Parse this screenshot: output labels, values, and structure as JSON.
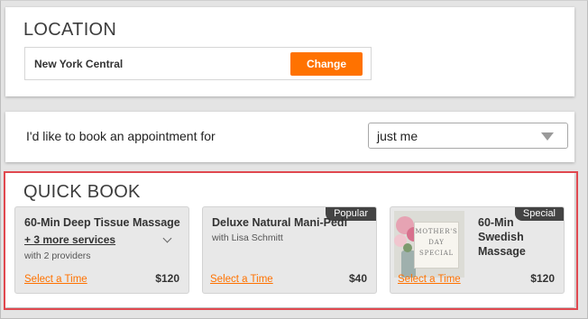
{
  "location": {
    "title": "LOCATION",
    "selected": "New York Central",
    "change_label": "Change"
  },
  "booking": {
    "label": "I'd like to book an appointment for",
    "selected": "just me"
  },
  "quick_book": {
    "title": "QUICK BOOK",
    "cards": [
      {
        "title": "60-Min Deep Tissue Massage",
        "more": "+ 3 more services",
        "sub": "with 2 providers",
        "select_label": "Select a Time",
        "price": "$120"
      },
      {
        "title": "Deluxe Natural Mani-Pedi",
        "sub": "with Lisa Schmitt",
        "tag": "Popular",
        "select_label": "Select a Time",
        "price": "$40"
      },
      {
        "title_lines": [
          "60-Min",
          "Swedish",
          "Massage"
        ],
        "tag": "Special",
        "image_text": [
          "MOTHER'S",
          "DAY",
          "SPECIAL"
        ],
        "select_label": "Select a Time",
        "price": "$120"
      }
    ]
  },
  "colors": {
    "accent": "#ff7200",
    "highlight_border": "#e0484f",
    "tag_bg": "#444444"
  }
}
